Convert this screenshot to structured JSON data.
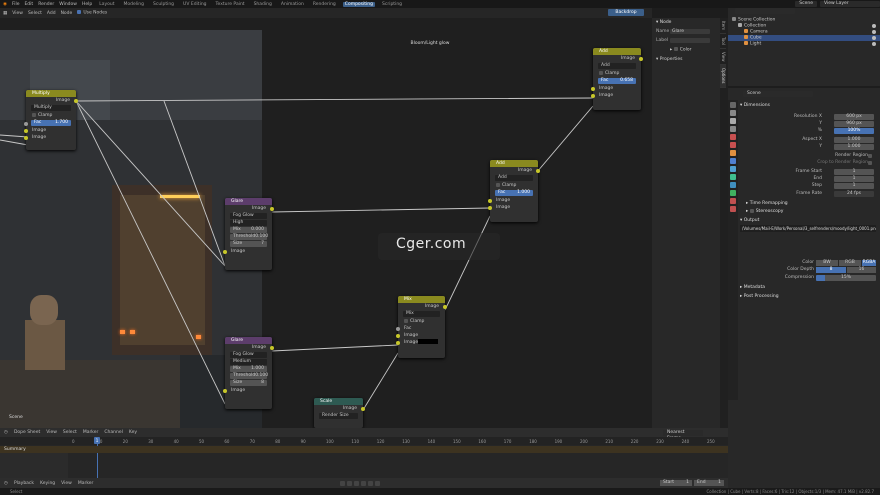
{
  "menu": [
    "File",
    "Edit",
    "Render",
    "Window",
    "Help"
  ],
  "workspaces": [
    "Layout",
    "Modeling",
    "Sculpting",
    "UV Editing",
    "Texture Paint",
    "Shading",
    "Animation",
    "Rendering",
    "Compositing",
    "Scripting"
  ],
  "active_workspace": "Compositing",
  "scene_name": "Scene",
  "view_layer": "View Layer",
  "node_header": {
    "items": [
      "View",
      "Select",
      "Add",
      "Node"
    ],
    "use_nodes": "Use Nodes",
    "backdrop": "Backdrop"
  },
  "canvas_title": "Bloom/Light glow",
  "canvas_scene_label": "Scene",
  "nodes": {
    "multiply": {
      "title": "Multiply",
      "out": "Image",
      "mode": "Multiply",
      "clamp": "Clamp",
      "fac_label": "Fac",
      "fac": "1.700",
      "in1": "Image",
      "in2": "Image"
    },
    "add_top": {
      "title": "Add",
      "out": "Image",
      "mode": "Add",
      "clamp": "Clamp",
      "fac_label": "Fac",
      "fac": "0.658",
      "in1": "Image",
      "in2": "Image"
    },
    "add_mid": {
      "title": "Add",
      "out": "Image",
      "mode": "Add",
      "clamp": "Clamp",
      "fac_label": "Fac",
      "fac": "1.000",
      "in1": "Image",
      "in2": "Image"
    },
    "glare1": {
      "title": "Glare",
      "out": "Image",
      "type": "Fog Glow",
      "quality": "High",
      "mix_label": "Mix",
      "mix": "0.000",
      "thr_label": "Threshold",
      "thr": "0.100",
      "size_label": "Size",
      "size": "7",
      "in": "Image"
    },
    "glare2": {
      "title": "Glare",
      "out": "Image",
      "type": "Fog Glow",
      "quality": "Medium",
      "mix_label": "Mix",
      "mix": "1.000",
      "thr_label": "Threshold",
      "thr": "0.100",
      "size_label": "Size",
      "size": "8",
      "in": "Image"
    },
    "mix": {
      "title": "Mix",
      "out": "Image",
      "mode": "Mix",
      "clamp": "Clamp",
      "fac_label": "Fac",
      "in1": "Image",
      "in2": "Image"
    },
    "scale": {
      "title": "Scale",
      "out": "Image",
      "mode": "Render Size",
      "in": "Image"
    }
  },
  "npanel": {
    "section": "Node",
    "name_label": "Name",
    "name": "Glare",
    "label_label": "Label",
    "color": "Color",
    "properties": "Properties"
  },
  "vtabs": [
    "Item",
    "Tool",
    "View",
    "Options"
  ],
  "outliner": {
    "root": "Scene Collection",
    "items": [
      {
        "name": "Collection"
      },
      {
        "name": "Camera"
      },
      {
        "name": "Cube"
      },
      {
        "name": "Light"
      }
    ]
  },
  "properties": {
    "scene": "Scene",
    "dimensions": "Dimensions",
    "rows": [
      {
        "label": "Resolution X",
        "value": "600 px"
      },
      {
        "label": "Y",
        "value": "960 px"
      },
      {
        "label": "%",
        "value": "100%"
      },
      {
        "label": "Aspect X",
        "value": "1.000"
      },
      {
        "label": "Y",
        "value": "1.000"
      },
      {
        "label": "Render Region",
        "value": ""
      },
      {
        "label": "Crop to Render Region",
        "value": ""
      },
      {
        "label": "Frame Start",
        "value": "1"
      },
      {
        "label": "End",
        "value": "1"
      },
      {
        "label": "Step",
        "value": "1"
      },
      {
        "label": "Frame Rate",
        "value": "24 fps"
      }
    ],
    "time_remapping": "Time Remapping",
    "stereoscopy": "Stereoscopy",
    "output": "Output",
    "output_path": "/Volumes/Mail-E/Work/Personal/3_selfrenders/moody/light_0001.png",
    "color_label": "Color",
    "color_opts": [
      "BW",
      "RGB",
      "RGBA"
    ],
    "depth_label": "Color Depth",
    "depth_opts": [
      "8",
      "16"
    ],
    "compression_label": "Compression",
    "compression": "15%",
    "metadata": "Metadata",
    "post_processing": "Post Processing"
  },
  "timeline": {
    "header": [
      "Dope Sheet",
      "View",
      "Select",
      "Marker",
      "Channel",
      "Key"
    ],
    "summary": "Summary",
    "current_frame": "1",
    "ticks": [
      "0",
      "10",
      "20",
      "30",
      "40",
      "50",
      "60",
      "70",
      "80",
      "90",
      "100",
      "110",
      "120",
      "130",
      "140",
      "150",
      "160",
      "170",
      "180",
      "190",
      "200",
      "210",
      "220",
      "230",
      "240",
      "250"
    ],
    "nearest": "Nearest Frame",
    "playback": [
      "Playback",
      "Keying",
      "View",
      "Marker"
    ],
    "start_label": "Start",
    "start": "1",
    "end_label": "End",
    "end": "1"
  },
  "status": {
    "left": "Select",
    "right": "Collection | Cube | Verts:8 | Faces:6 | Tris:12 | Objects:1/3 | Mem: 47.1 MiB | v2.82.7"
  },
  "watermark": "Cger.com"
}
